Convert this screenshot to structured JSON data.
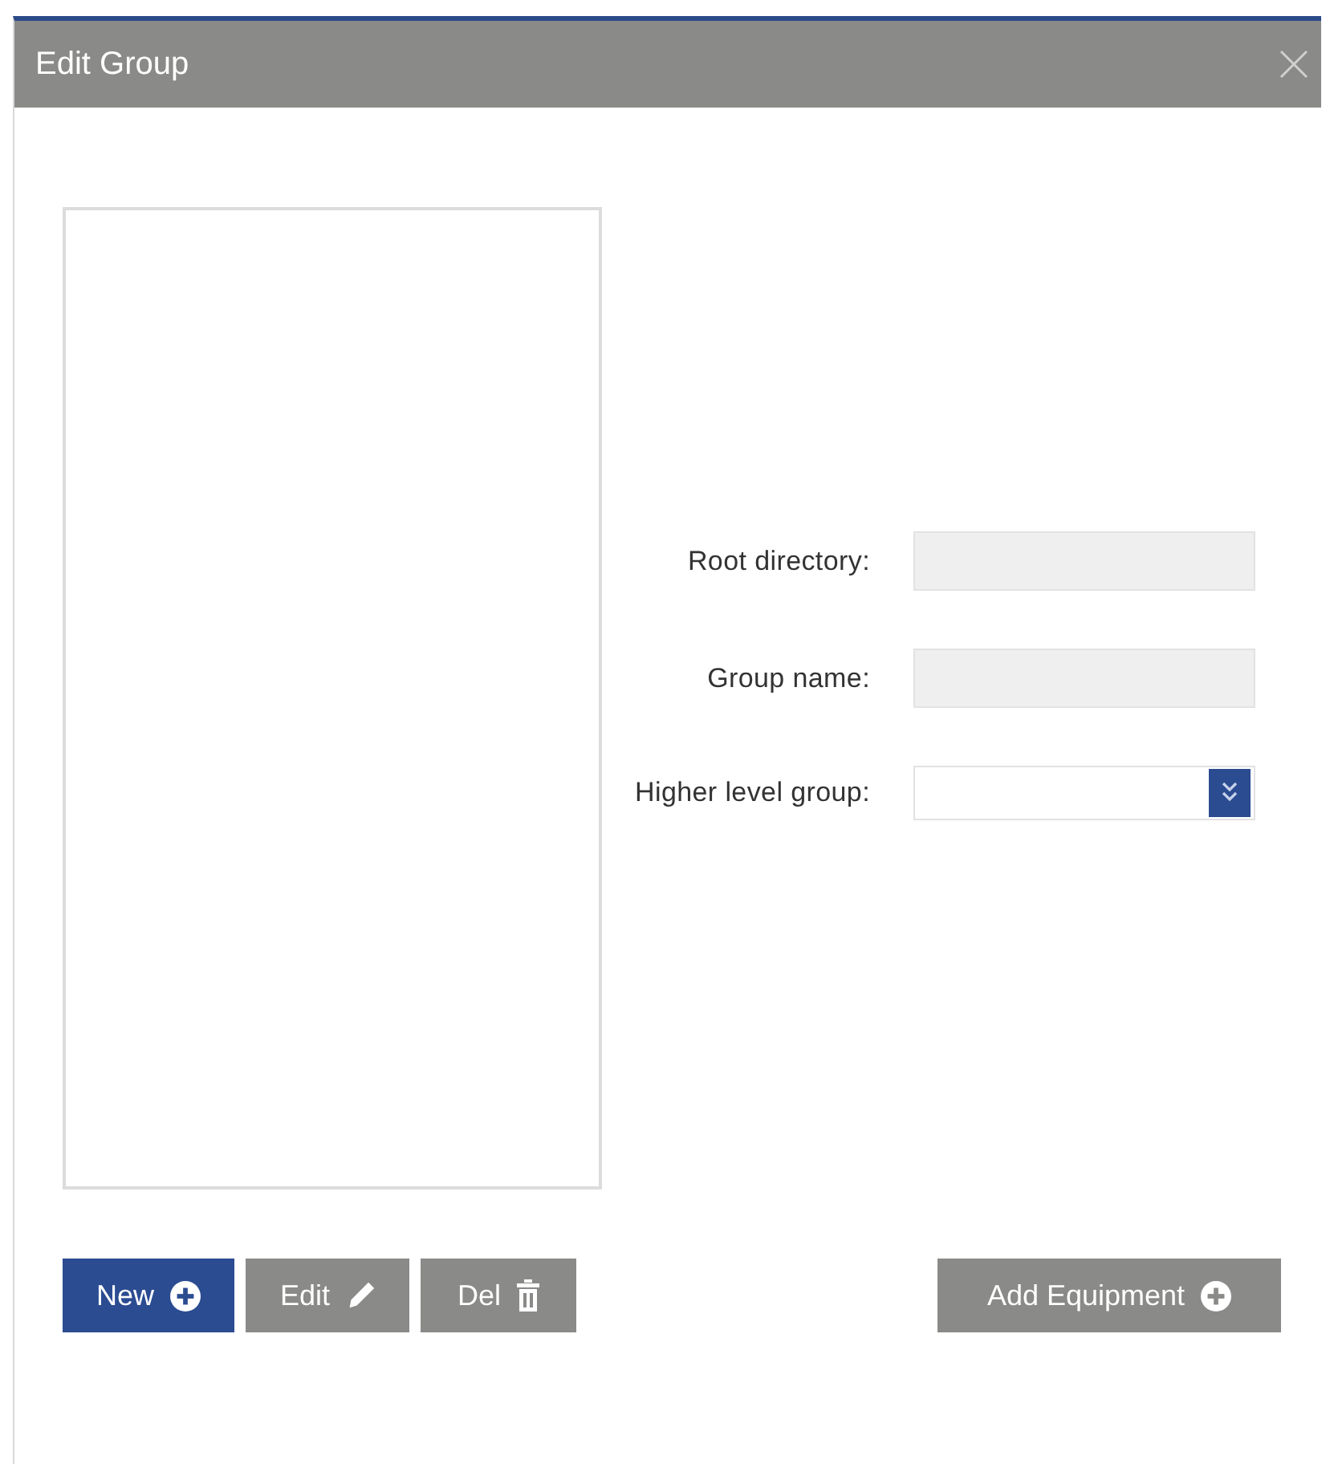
{
  "window": {
    "title": "Edit Group"
  },
  "form": {
    "fields": [
      {
        "label": "Root directory:",
        "kind": "text",
        "disabled": true
      },
      {
        "label": "Group name:",
        "kind": "text",
        "disabled": true
      },
      {
        "label": "Higher level group:",
        "kind": "select",
        "disabled": false
      }
    ]
  },
  "buttons": [
    {
      "label": "New",
      "kind": "primary"
    },
    {
      "label": "Edit",
      "kind": "default"
    },
    {
      "label": "Del",
      "kind": "default"
    }
  ],
  "side_buttons": [
    {
      "label": "Add Equipment",
      "kind": "default"
    }
  ]
}
